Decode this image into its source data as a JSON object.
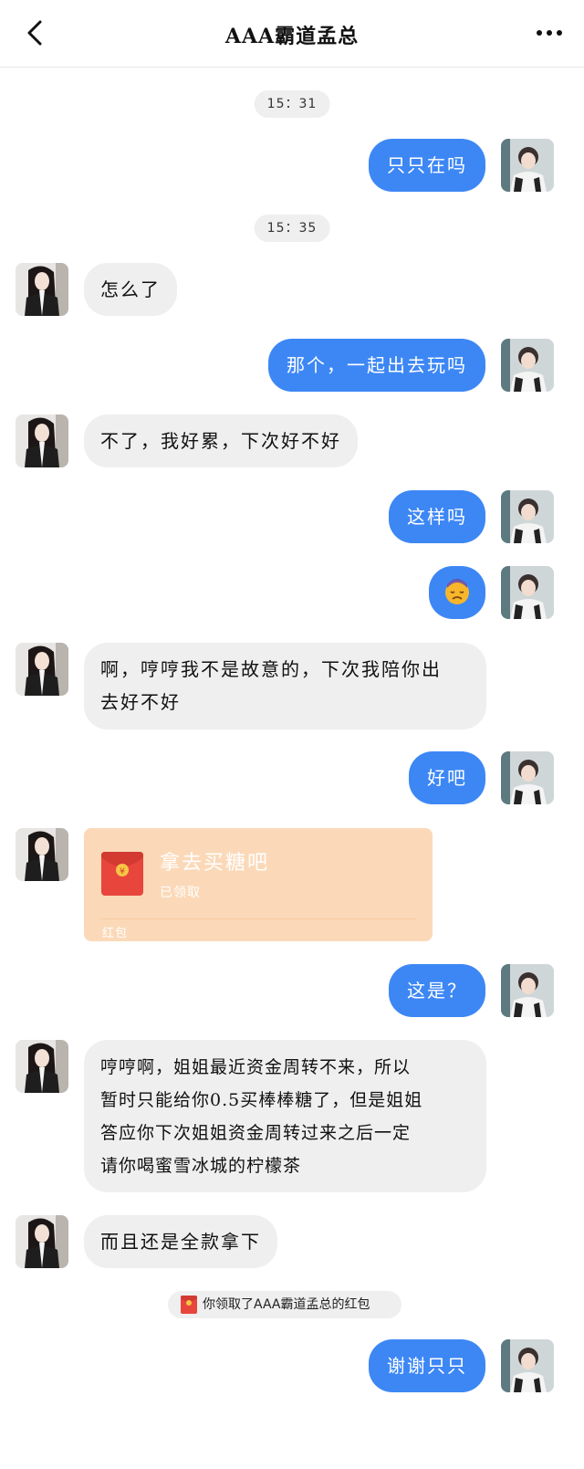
{
  "header": {
    "title": "AAA霸道孟总",
    "back_icon": "chevron-left-icon",
    "more_icon": "more-dots-icon"
  },
  "timestamps": [
    "15：31",
    "15：35"
  ],
  "messages": [
    {
      "side": "right",
      "text": "只只在吗"
    },
    {
      "side": "left",
      "text": "怎么了"
    },
    {
      "side": "right",
      "text": "那个，一起出去玩吗"
    },
    {
      "side": "left",
      "text": "不了，我好累，下次好不好"
    },
    {
      "side": "right",
      "text": "这样吗"
    },
    {
      "side": "right",
      "emoji": "sad-face-emoji"
    },
    {
      "side": "left",
      "lines": [
        "啊，哼哼我不是故意的，下次我陪你出",
        "去好不好"
      ]
    },
    {
      "side": "right",
      "text": "好吧"
    },
    {
      "side": "right",
      "text": "这是？"
    },
    {
      "side": "left",
      "lines": [
        "哼哼啊，姐姐最近资金周转不来，所以",
        "暂时只能给你0.5买棒棒糖了，但是姐姐",
        "答应你下次姐姐资金周转过来之后一定",
        "请你喝蜜雪冰城的柠檬茶"
      ]
    },
    {
      "side": "left",
      "text": "而且还是全款拿下"
    },
    {
      "side": "right",
      "text": "谢谢只只"
    }
  ],
  "red_packet": {
    "title": "拿去买糖吧",
    "status": "已领取",
    "label": "红包"
  },
  "notice": {
    "text": "你领取了AAA霸道孟总的红包",
    "icon": "red-packet-icon"
  },
  "colors": {
    "right_bubble": "#3d87f5",
    "left_bubble": "#efefef",
    "red_packet_bg": "#fbd9b8",
    "red_packet_icon": "#e8453c"
  }
}
